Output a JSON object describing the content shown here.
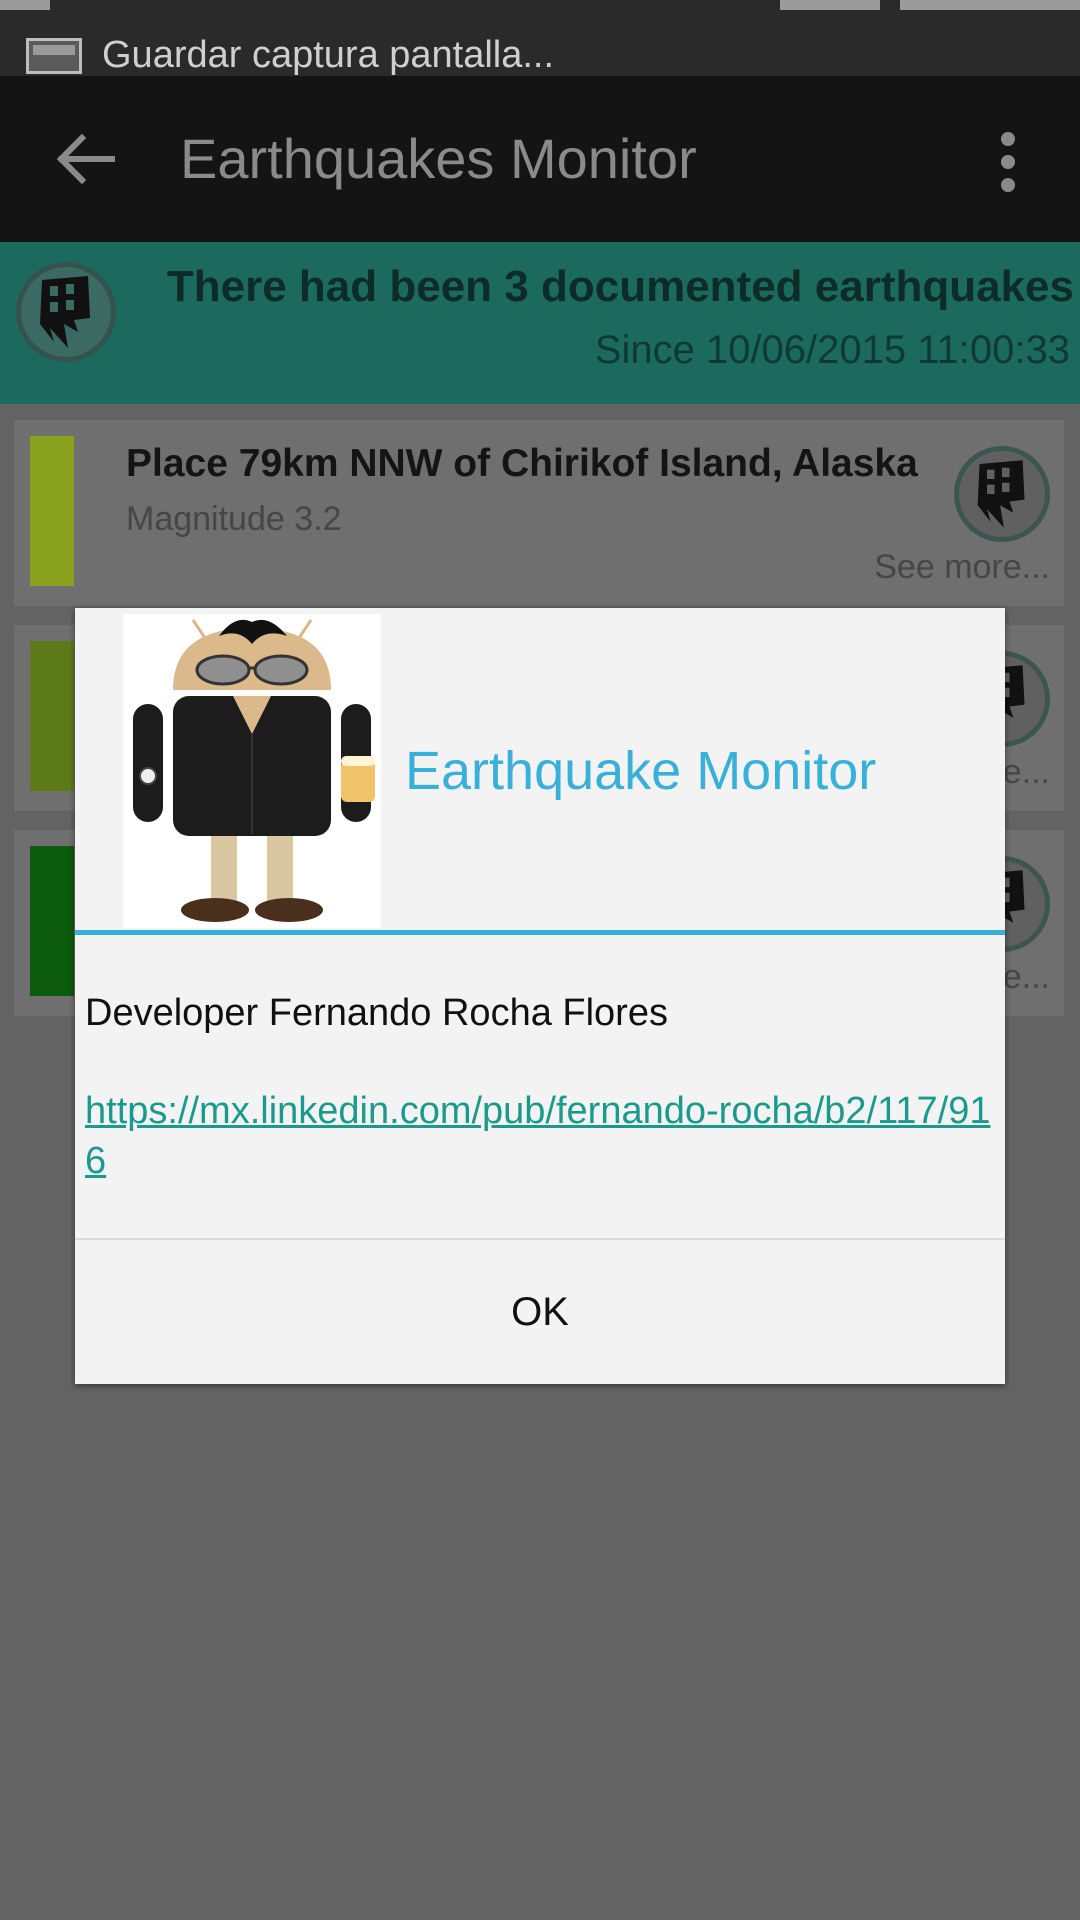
{
  "status_bar": {
    "notification_text": "Guardar captura pantalla..."
  },
  "app_bar": {
    "title": "Earthquakes Monitor"
  },
  "summary": {
    "count_text": "There had been 3 documented earthquakes",
    "since_text": "Since 10/06/2015 11:00:33"
  },
  "earthquakes": [
    {
      "place": "Place 79km NNW of Chirikof Island, Alaska",
      "magnitude": "Magnitude 3.2",
      "see_more": "See more...",
      "color": "#8aa11e"
    },
    {
      "place": "",
      "magnitude": "",
      "see_more": "See more...",
      "color": "#5d7a18"
    },
    {
      "place": "",
      "magnitude": "",
      "see_more": "See more...",
      "color": "#0c5a0c"
    }
  ],
  "dialog": {
    "title": "Earthquake Monitor",
    "developer": "Developer Fernando Rocha Flores",
    "link": "https://mx.linkedin.com/pub/fernando-rocha/b2/117/916",
    "ok_label": "OK"
  },
  "colors": {
    "accent": "#39b0d9",
    "banner": "#1c6a5e",
    "link": "#1a9a8c"
  }
}
